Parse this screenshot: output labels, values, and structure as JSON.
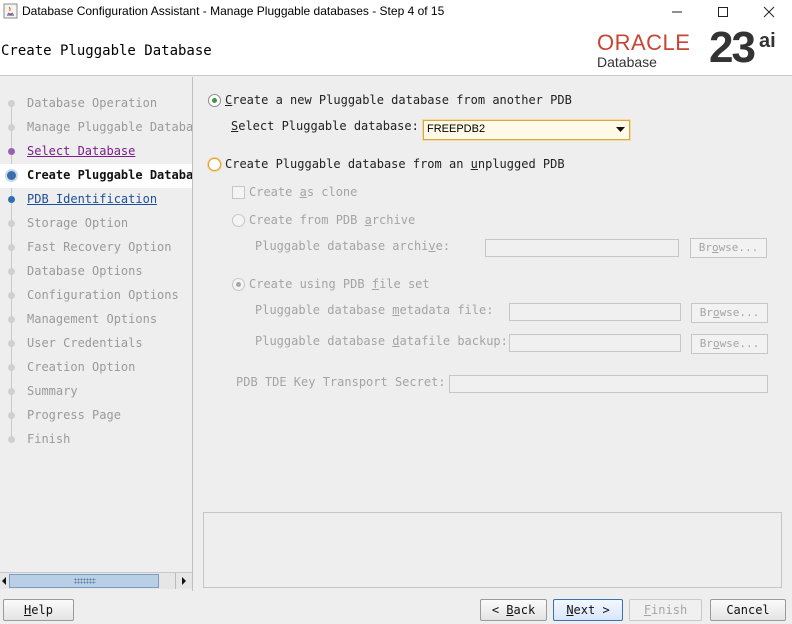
{
  "window": {
    "title": "Database Configuration Assistant - Manage Pluggable databases - Step 4 of 15"
  },
  "header": {
    "page_title": "Create Pluggable Database",
    "brand": {
      "name": "ORACLE",
      "product": "Database",
      "version": "23",
      "suffix": "ai",
      "brand_color": "#c74634"
    }
  },
  "nav": {
    "items": [
      {
        "label": "Database Operation",
        "state": "done"
      },
      {
        "label": "Manage Pluggable Databases",
        "state": "done"
      },
      {
        "label": "Select Database",
        "state": "visited"
      },
      {
        "label": "Create Pluggable Database",
        "state": "current"
      },
      {
        "label": "PDB Identification",
        "state": "next"
      },
      {
        "label": "Storage Option",
        "state": "pending"
      },
      {
        "label": "Fast Recovery Option",
        "state": "pending"
      },
      {
        "label": "Database Options",
        "state": "pending"
      },
      {
        "label": "Configuration Options",
        "state": "pending"
      },
      {
        "label": "Management Options",
        "state": "pending"
      },
      {
        "label": "User Credentials",
        "state": "pending"
      },
      {
        "label": "Creation Option",
        "state": "pending"
      },
      {
        "label": "Summary",
        "state": "pending"
      },
      {
        "label": "Progress Page",
        "state": "pending"
      },
      {
        "label": "Finish",
        "state": "pending"
      }
    ]
  },
  "form": {
    "option_from_pdb": {
      "pre": "",
      "mnemonic": "C",
      "post": "reate a new Pluggable database from another PDB",
      "selected": true
    },
    "select_pdb_label": {
      "pre": "",
      "mnemonic": "S",
      "post": "elect Pluggable database:"
    },
    "select_pdb_value": "FREEPDB2",
    "option_unplugged": {
      "pre": "Create Pluggable database from an ",
      "mnemonic": "u",
      "post": "nplugged PDB",
      "selected": false
    },
    "create_as_clone": {
      "pre": "Create ",
      "mnemonic": "a",
      "post": "s clone"
    },
    "from_archive": {
      "pre": "Create from PDB ",
      "mnemonic": "a",
      "post": "rchive"
    },
    "archive_label": {
      "pre": "Pluggable database archi",
      "mnemonic": "v",
      "post": "e:"
    },
    "browse": {
      "pre": "Br",
      "mnemonic": "o",
      "post": "wse..."
    },
    "using_file_set": {
      "pre": "Create using PDB ",
      "mnemonic": "f",
      "post": "ile set"
    },
    "metadata_label": {
      "pre": "Pluggable database ",
      "mnemonic": "m",
      "post": "etadata file:"
    },
    "datafile_label": {
      "pre": "Pluggable database ",
      "mnemonic": "d",
      "post": "atafile backup:"
    },
    "tde_label": "PDB TDE Key Transport Secret:"
  },
  "buttons": {
    "help": {
      "pre": "",
      "mnemonic": "H",
      "post": "elp"
    },
    "back": {
      "pre": "< ",
      "mnemonic": "B",
      "post": "ack"
    },
    "next": {
      "pre": "",
      "mnemonic": "N",
      "post": "ext >"
    },
    "finish": {
      "pre": "",
      "mnemonic": "F",
      "post": "inish"
    },
    "cancel": "Cancel"
  }
}
